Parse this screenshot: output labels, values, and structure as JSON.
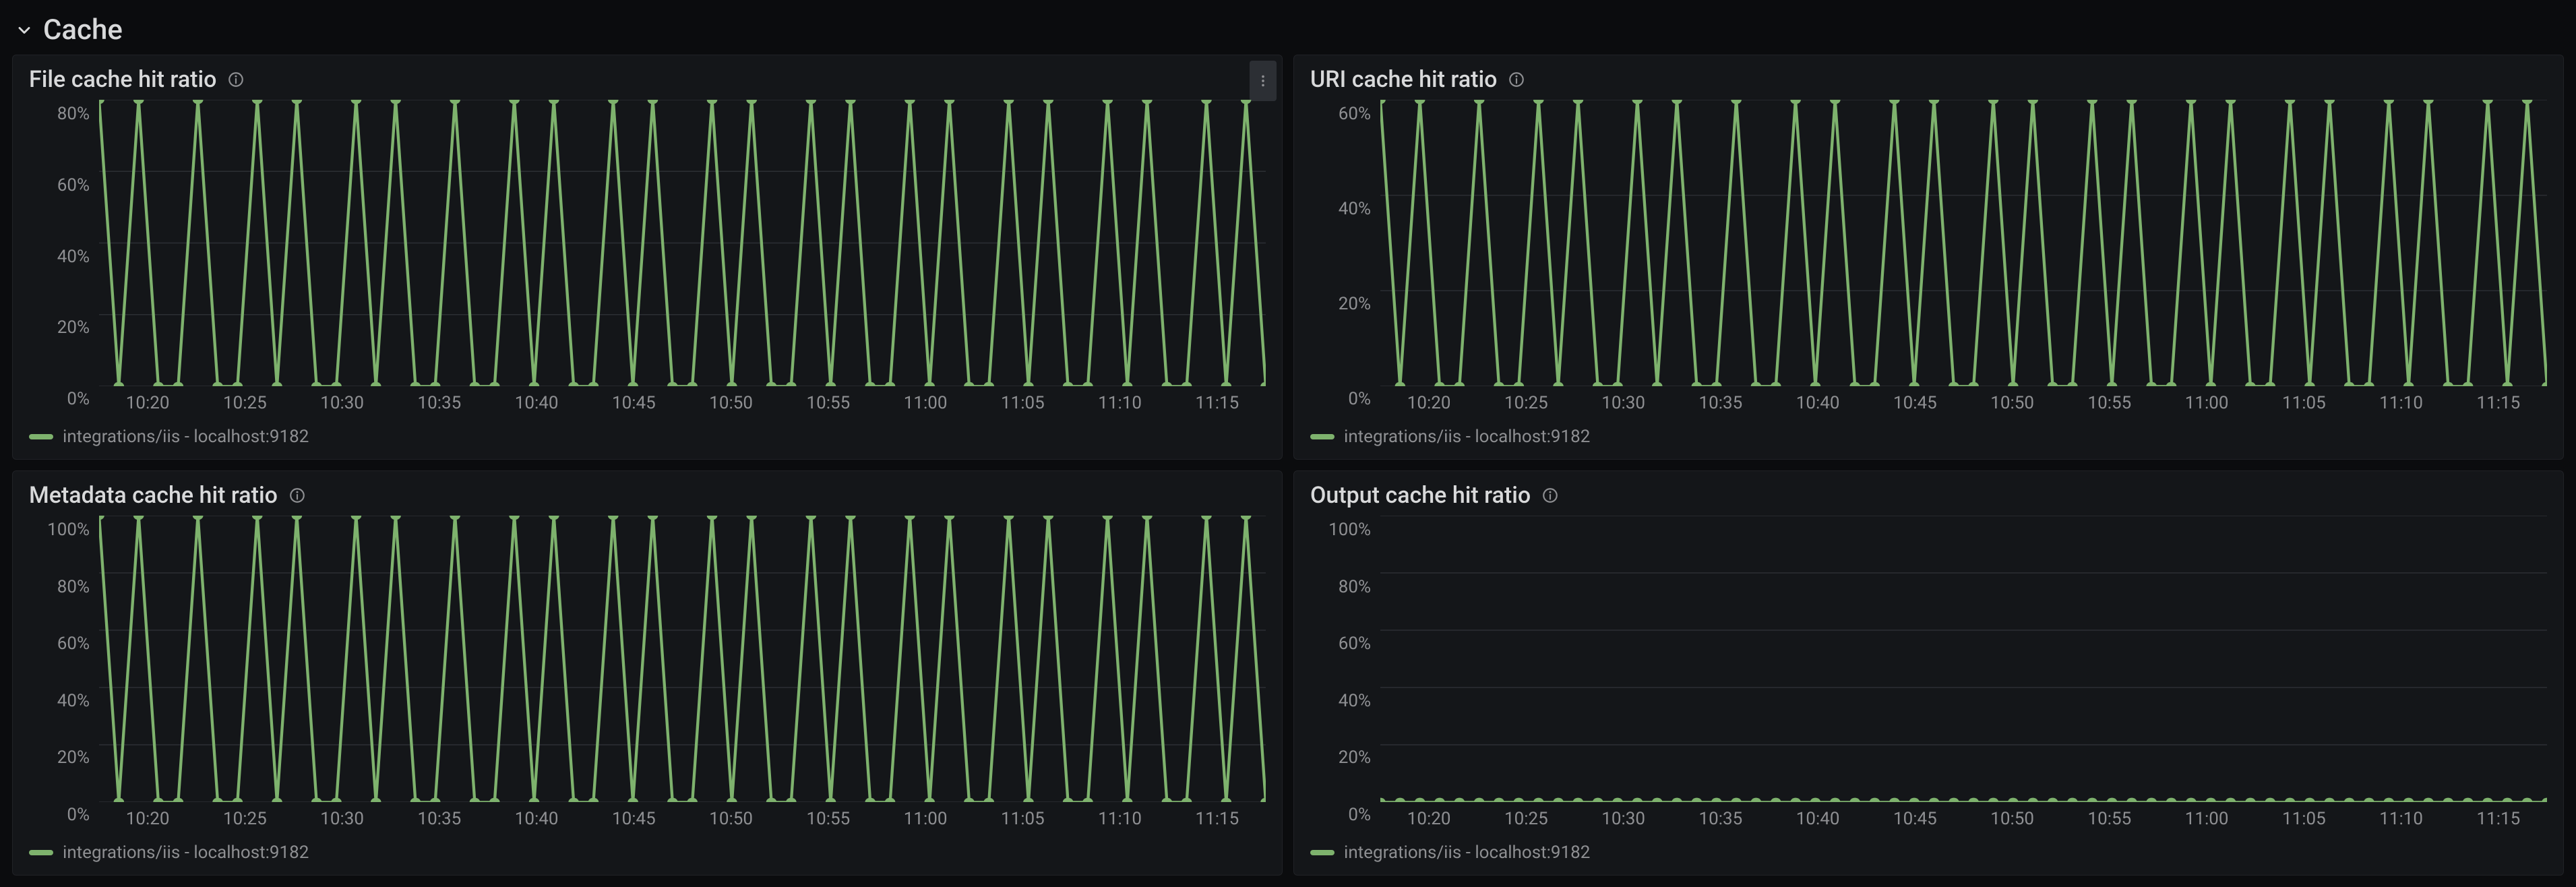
{
  "row": {
    "title": "Cache"
  },
  "x_ticks": [
    "10:20",
    "10:25",
    "10:30",
    "10:35",
    "10:40",
    "10:45",
    "10:50",
    "10:55",
    "11:00",
    "11:05",
    "11:10",
    "11:15"
  ],
  "panels": {
    "file": {
      "title": "File cache hit ratio",
      "legend": "integrations/iis - localhost:9182",
      "show_menu": true
    },
    "uri": {
      "title": "URI cache hit ratio",
      "legend": "integrations/iis - localhost:9182",
      "show_menu": false
    },
    "metadata": {
      "title": "Metadata cache hit ratio",
      "legend": "integrations/iis - localhost:9182",
      "show_menu": false
    },
    "output": {
      "title": "Output cache hit ratio",
      "legend": "integrations/iis - localhost:9182",
      "show_menu": false
    }
  },
  "chart_data": [
    {
      "id": "file",
      "type": "line",
      "title": "File cache hit ratio",
      "xlabel": "",
      "ylabel": "",
      "ylim": [
        0,
        80
      ],
      "y_ticks": [
        "80%",
        "60%",
        "40%",
        "20%",
        "0%"
      ],
      "x": [
        "10:17",
        "10:18",
        "10:19",
        "10:20",
        "10:21",
        "10:22",
        "10:23",
        "10:24",
        "10:25",
        "10:26",
        "10:27",
        "10:28",
        "10:29",
        "10:30",
        "10:31",
        "10:32",
        "10:33",
        "10:34",
        "10:35",
        "10:36",
        "10:37",
        "10:38",
        "10:39",
        "10:40",
        "10:41",
        "10:42",
        "10:43",
        "10:44",
        "10:45",
        "10:46",
        "10:47",
        "10:48",
        "10:49",
        "10:50",
        "10:51",
        "10:52",
        "10:53",
        "10:54",
        "10:55",
        "10:56",
        "10:57",
        "10:58",
        "10:59",
        "11:00",
        "11:01",
        "11:02",
        "11:03",
        "11:04",
        "11:05",
        "11:06",
        "11:07",
        "11:08",
        "11:09",
        "11:10",
        "11:11",
        "11:12",
        "11:13",
        "11:14",
        "11:15",
        "11:16"
      ],
      "series": [
        {
          "name": "integrations/iis - localhost:9182",
          "values": [
            80,
            0,
            80,
            0,
            0,
            80,
            0,
            0,
            80,
            0,
            80,
            0,
            0,
            80,
            0,
            80,
            0,
            0,
            80,
            0,
            0,
            80,
            0,
            80,
            0,
            0,
            80,
            0,
            80,
            0,
            0,
            80,
            0,
            80,
            0,
            0,
            80,
            0,
            80,
            0,
            0,
            80,
            0,
            80,
            0,
            0,
            80,
            0,
            80,
            0,
            0,
            80,
            0,
            80,
            0,
            0,
            80,
            0,
            80,
            0
          ]
        }
      ]
    },
    {
      "id": "uri",
      "type": "line",
      "title": "URI cache hit ratio",
      "xlabel": "",
      "ylabel": "",
      "ylim": [
        0,
        60
      ],
      "y_ticks": [
        "60%",
        "40%",
        "20%",
        "0%"
      ],
      "x": [
        "10:17",
        "10:18",
        "10:19",
        "10:20",
        "10:21",
        "10:22",
        "10:23",
        "10:24",
        "10:25",
        "10:26",
        "10:27",
        "10:28",
        "10:29",
        "10:30",
        "10:31",
        "10:32",
        "10:33",
        "10:34",
        "10:35",
        "10:36",
        "10:37",
        "10:38",
        "10:39",
        "10:40",
        "10:41",
        "10:42",
        "10:43",
        "10:44",
        "10:45",
        "10:46",
        "10:47",
        "10:48",
        "10:49",
        "10:50",
        "10:51",
        "10:52",
        "10:53",
        "10:54",
        "10:55",
        "10:56",
        "10:57",
        "10:58",
        "10:59",
        "11:00",
        "11:01",
        "11:02",
        "11:03",
        "11:04",
        "11:05",
        "11:06",
        "11:07",
        "11:08",
        "11:09",
        "11:10",
        "11:11",
        "11:12",
        "11:13",
        "11:14",
        "11:15",
        "11:16"
      ],
      "series": [
        {
          "name": "integrations/iis - localhost:9182",
          "values": [
            60,
            0,
            60,
            0,
            0,
            60,
            0,
            0,
            60,
            0,
            60,
            0,
            0,
            60,
            0,
            60,
            0,
            0,
            60,
            0,
            0,
            60,
            0,
            60,
            0,
            0,
            60,
            0,
            60,
            0,
            0,
            60,
            0,
            60,
            0,
            0,
            60,
            0,
            60,
            0,
            0,
            60,
            0,
            60,
            0,
            0,
            60,
            0,
            60,
            0,
            0,
            60,
            0,
            60,
            0,
            0,
            60,
            0,
            60,
            0
          ]
        }
      ]
    },
    {
      "id": "metadata",
      "type": "line",
      "title": "Metadata cache hit ratio",
      "xlabel": "",
      "ylabel": "",
      "ylim": [
        0,
        100
      ],
      "y_ticks": [
        "100%",
        "80%",
        "60%",
        "40%",
        "20%",
        "0%"
      ],
      "x": [
        "10:17",
        "10:18",
        "10:19",
        "10:20",
        "10:21",
        "10:22",
        "10:23",
        "10:24",
        "10:25",
        "10:26",
        "10:27",
        "10:28",
        "10:29",
        "10:30",
        "10:31",
        "10:32",
        "10:33",
        "10:34",
        "10:35",
        "10:36",
        "10:37",
        "10:38",
        "10:39",
        "10:40",
        "10:41",
        "10:42",
        "10:43",
        "10:44",
        "10:45",
        "10:46",
        "10:47",
        "10:48",
        "10:49",
        "10:50",
        "10:51",
        "10:52",
        "10:53",
        "10:54",
        "10:55",
        "10:56",
        "10:57",
        "10:58",
        "10:59",
        "11:00",
        "11:01",
        "11:02",
        "11:03",
        "11:04",
        "11:05",
        "11:06",
        "11:07",
        "11:08",
        "11:09",
        "11:10",
        "11:11",
        "11:12",
        "11:13",
        "11:14",
        "11:15",
        "11:16"
      ],
      "series": [
        {
          "name": "integrations/iis - localhost:9182",
          "values": [
            100,
            0,
            100,
            0,
            0,
            100,
            0,
            0,
            100,
            0,
            100,
            0,
            0,
            100,
            0,
            100,
            0,
            0,
            100,
            0,
            0,
            100,
            0,
            100,
            0,
            0,
            100,
            0,
            100,
            0,
            0,
            100,
            0,
            100,
            0,
            0,
            100,
            0,
            100,
            0,
            0,
            100,
            0,
            100,
            0,
            0,
            100,
            0,
            100,
            0,
            0,
            100,
            0,
            100,
            0,
            0,
            100,
            0,
            100,
            0
          ]
        }
      ]
    },
    {
      "id": "output",
      "type": "line",
      "title": "Output cache hit ratio",
      "xlabel": "",
      "ylabel": "",
      "ylim": [
        0,
        100
      ],
      "y_ticks": [
        "100%",
        "80%",
        "60%",
        "40%",
        "20%",
        "0%"
      ],
      "x": [
        "10:17",
        "10:18",
        "10:19",
        "10:20",
        "10:21",
        "10:22",
        "10:23",
        "10:24",
        "10:25",
        "10:26",
        "10:27",
        "10:28",
        "10:29",
        "10:30",
        "10:31",
        "10:32",
        "10:33",
        "10:34",
        "10:35",
        "10:36",
        "10:37",
        "10:38",
        "10:39",
        "10:40",
        "10:41",
        "10:42",
        "10:43",
        "10:44",
        "10:45",
        "10:46",
        "10:47",
        "10:48",
        "10:49",
        "10:50",
        "10:51",
        "10:52",
        "10:53",
        "10:54",
        "10:55",
        "10:56",
        "10:57",
        "10:58",
        "10:59",
        "11:00",
        "11:01",
        "11:02",
        "11:03",
        "11:04",
        "11:05",
        "11:06",
        "11:07",
        "11:08",
        "11:09",
        "11:10",
        "11:11",
        "11:12",
        "11:13",
        "11:14",
        "11:15",
        "11:16"
      ],
      "series": [
        {
          "name": "integrations/iis - localhost:9182",
          "values": [
            0,
            0,
            0,
            0,
            0,
            0,
            0,
            0,
            0,
            0,
            0,
            0,
            0,
            0,
            0,
            0,
            0,
            0,
            0,
            0,
            0,
            0,
            0,
            0,
            0,
            0,
            0,
            0,
            0,
            0,
            0,
            0,
            0,
            0,
            0,
            0,
            0,
            0,
            0,
            0,
            0,
            0,
            0,
            0,
            0,
            0,
            0,
            0,
            0,
            0,
            0,
            0,
            0,
            0,
            0,
            0,
            0,
            0,
            0,
            0
          ]
        }
      ]
    }
  ]
}
